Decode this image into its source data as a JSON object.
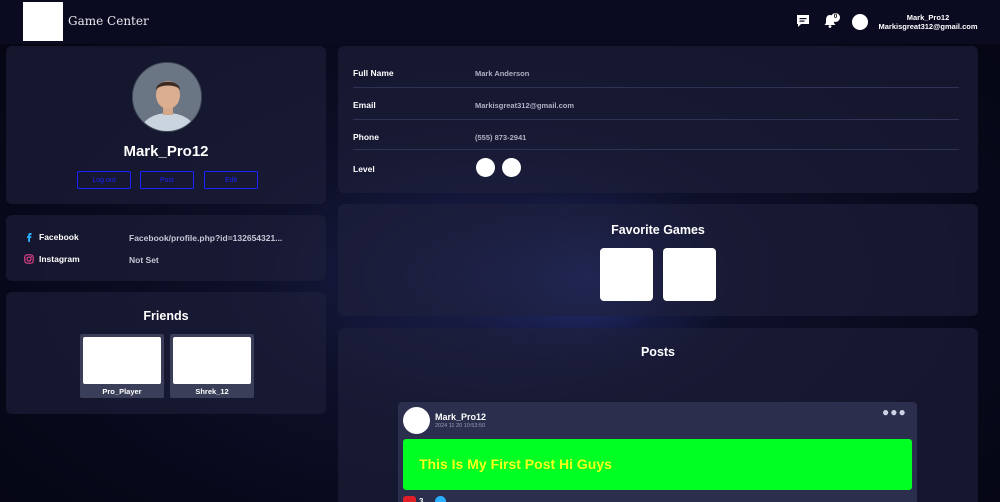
{
  "header": {
    "title": "Game Center",
    "notification_count": "0",
    "user_name": "Mark_Pro12",
    "user_email": "Markisgreat312@gmail.com"
  },
  "profile": {
    "username": "Mark_Pro12",
    "buttons": {
      "logout": "Log out",
      "post": "Post",
      "edit": "Edit"
    }
  },
  "social": [
    {
      "label": "Facebook",
      "value": "Facebook/profile.php?id=132654321...",
      "icon": "facebook-icon"
    },
    {
      "label": "Instagram",
      "value": "Not Set",
      "icon": "instagram-icon"
    }
  ],
  "friends": {
    "title": "Friends",
    "items": [
      {
        "name": "Pro_Player"
      },
      {
        "name": "Shrek_12"
      }
    ]
  },
  "info": {
    "full_name_label": "Full Name",
    "full_name": "Mark Anderson",
    "email_label": "Email",
    "email": "Markisgreat312@gmail.com",
    "phone_label": "Phone",
    "phone": "(555) 873-2941",
    "level_label": "Level"
  },
  "favorites": {
    "title": "Favorite Games"
  },
  "posts": {
    "title": "Posts",
    "items": [
      {
        "user": "Mark_Pro12",
        "time": "2024 11 20 10:53:50",
        "text": "This Is My First Post Hi Guys",
        "like_count": "3"
      }
    ]
  },
  "colors": {
    "accent_button": "#1c23ff",
    "post_background": "#00ff22",
    "post_text": "#f4ff1a",
    "like": "#e01f2a",
    "instagram": "#e0408c",
    "facebook": "#2ab0ff"
  }
}
